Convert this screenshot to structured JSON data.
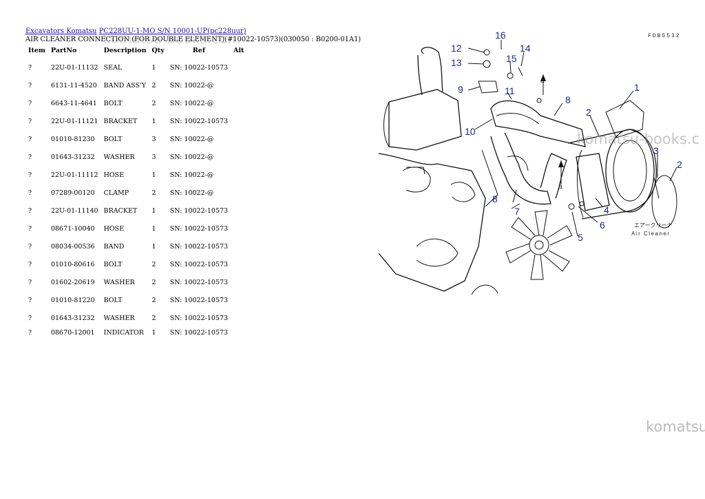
{
  "breadcrumb": {
    "part1": "Excavators Komatsu",
    "part2": "PC228UU-1-MO S/N 10001-UP(pc228uur)"
  },
  "page_title": "AIR CLEANER CONNECTION (FOR DOUBLE ELEMENT)(#10022-10573)(030050 : B0200-01A1)",
  "watermarks": {
    "top": "komatsu-books.com",
    "middle": "komatsu-books.c",
    "bottom": "komatsu"
  },
  "table": {
    "headers": {
      "item": "Item",
      "partno": "PartNo",
      "description": "Description",
      "qty": "Qty",
      "ref": "Ref",
      "alt": "Alt"
    },
    "rows": [
      {
        "item": "?",
        "partno": "22U-01-11132",
        "description": "SEAL",
        "qty": "1",
        "ref": "SN: 10022-10573"
      },
      {
        "item": "?",
        "partno": "6131-11-4520",
        "description": "BAND ASS'Y",
        "qty": "2",
        "ref": "SN: 10022-@"
      },
      {
        "item": "?",
        "partno": "6643-11-4641",
        "description": "BOLT",
        "qty": "2",
        "ref": "SN: 10022-@"
      },
      {
        "item": "?",
        "partno": "22U-01-11121",
        "description": "BRACKET",
        "qty": "1",
        "ref": "SN: 10022-10573"
      },
      {
        "item": "?",
        "partno": "01010-81230",
        "description": "BOLT",
        "qty": "3",
        "ref": "SN: 10022-@"
      },
      {
        "item": "?",
        "partno": "01643-31232",
        "description": "WASHER",
        "qty": "3",
        "ref": "SN: 10022-@"
      },
      {
        "item": "?",
        "partno": "22U-01-11112",
        "description": "HOSE",
        "qty": "1",
        "ref": "SN: 10022-@"
      },
      {
        "item": "?",
        "partno": "07289-00120",
        "description": "CLAMP",
        "qty": "2",
        "ref": "SN: 10022-@"
      },
      {
        "item": "?",
        "partno": "22U-01-11140",
        "description": "BRACKET",
        "qty": "1",
        "ref": "SN: 10022-10573"
      },
      {
        "item": "?",
        "partno": "08671-10040",
        "description": "HOSE",
        "qty": "1",
        "ref": "SN: 10022-10573"
      },
      {
        "item": "?",
        "partno": "08034-00536",
        "description": "BAND",
        "qty": "1",
        "ref": "SN: 10022-10573"
      },
      {
        "item": "?",
        "partno": "01010-80616",
        "description": "BOLT",
        "qty": "2",
        "ref": "SN: 10022-10573"
      },
      {
        "item": "?",
        "partno": "01602-20619",
        "description": "WASHER",
        "qty": "2",
        "ref": "SN: 10022-10573"
      },
      {
        "item": "?",
        "partno": "01010-81220",
        "description": "BOLT",
        "qty": "2",
        "ref": "SN: 10022-10573"
      },
      {
        "item": "?",
        "partno": "01643-31232",
        "description": "WASHER",
        "qty": "2",
        "ref": "SN: 10022-10573"
      },
      {
        "item": "?",
        "partno": "08670-12001",
        "description": "INDICATOR",
        "qty": "1",
        "ref": "SN: 10022-10573"
      }
    ]
  },
  "diagram": {
    "code": "FDB5532",
    "callouts": [
      "1",
      "2",
      "3",
      "2",
      "4",
      "5",
      "6",
      "7",
      "8",
      "8",
      "9",
      "10",
      "11",
      "12",
      "13",
      "14",
      "15",
      "16"
    ],
    "view_markers": [
      "a",
      "a"
    ],
    "label_jp": "エアークリーナ",
    "label_en": "Air Cleaner"
  },
  "colors": {
    "link": "#1a0dab",
    "callout": "#1b2a8a"
  }
}
